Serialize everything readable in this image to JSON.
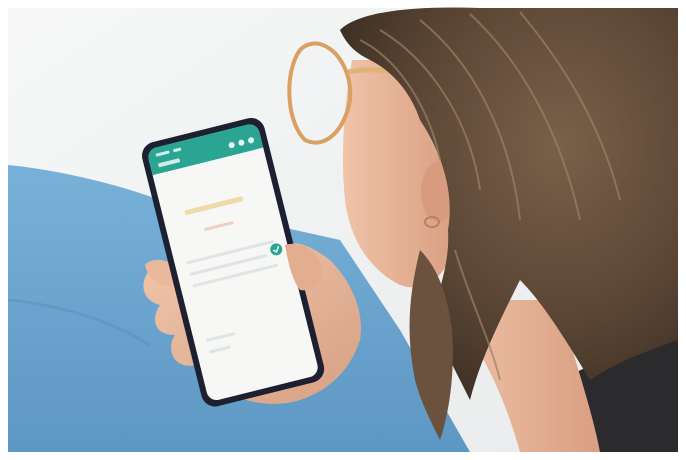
{
  "scene": {
    "description_free": true,
    "colors": {
      "frame": "#ffffff",
      "wall": "#f3f4f4",
      "sofa": "#6fa9d2",
      "sofa_shadow": "#5489b3",
      "hair": "#8a7058",
      "hair_dark": "#4e3c2d",
      "skin": "#e9b99d",
      "skin_shadow": "#c98f72",
      "glasses": "#d9a062",
      "shirt": "#2b2a2c",
      "phone_body": "#1d2030",
      "phone_bar": "#2aa593",
      "phone_screen": "#f7f8f6",
      "screen_accent": "#e8c86f",
      "screen_check": "#2aa593"
    }
  },
  "phone": {
    "app_bar_label": "",
    "icons": [
      "status-bar-icons",
      "app-bar-actions",
      "check-badge-icon"
    ]
  }
}
